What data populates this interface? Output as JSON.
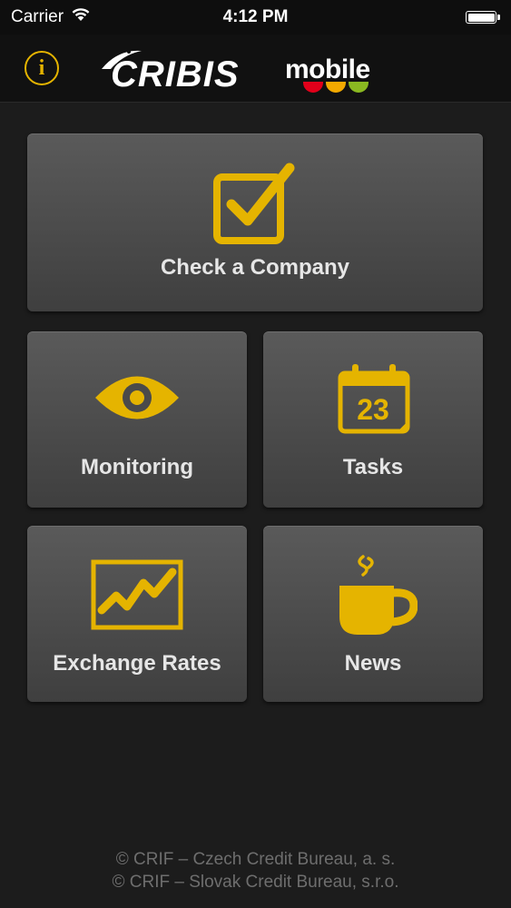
{
  "status_bar": {
    "carrier": "Carrier",
    "time": "4:12 PM",
    "icons": [
      "wifi-icon",
      "battery-icon"
    ]
  },
  "header": {
    "info_glyph": "i",
    "brand": "CRIBIS",
    "brand_suffix": "mobile",
    "info_icon": "info-icon",
    "accent_color": "#e5b400",
    "logo_dot_colors": [
      "#e2001a",
      "#f2a900",
      "#8ab821"
    ]
  },
  "tiles": {
    "check_company": {
      "label": "Check a Company",
      "icon": "checkbox-check-icon"
    },
    "monitoring": {
      "label": "Monitoring",
      "icon": "eye-icon"
    },
    "tasks": {
      "label": "Tasks",
      "icon": "calendar-icon",
      "calendar_day": "23"
    },
    "exchange_rates": {
      "label": "Exchange Rates",
      "icon": "chart-trend-icon"
    },
    "news": {
      "label": "News",
      "icon": "coffee-cup-icon"
    }
  },
  "footer": {
    "line1": "© CRIF – Czech Credit Bureau, a. s.",
    "line2": "© CRIF – Slovak Credit Bureau, s.r.o."
  },
  "colors": {
    "background": "#1c1c1c",
    "tile": "#4d4d4d",
    "icon": "#e5b400",
    "label": "#e6e6e6",
    "footer_text": "#6e6e6e"
  }
}
